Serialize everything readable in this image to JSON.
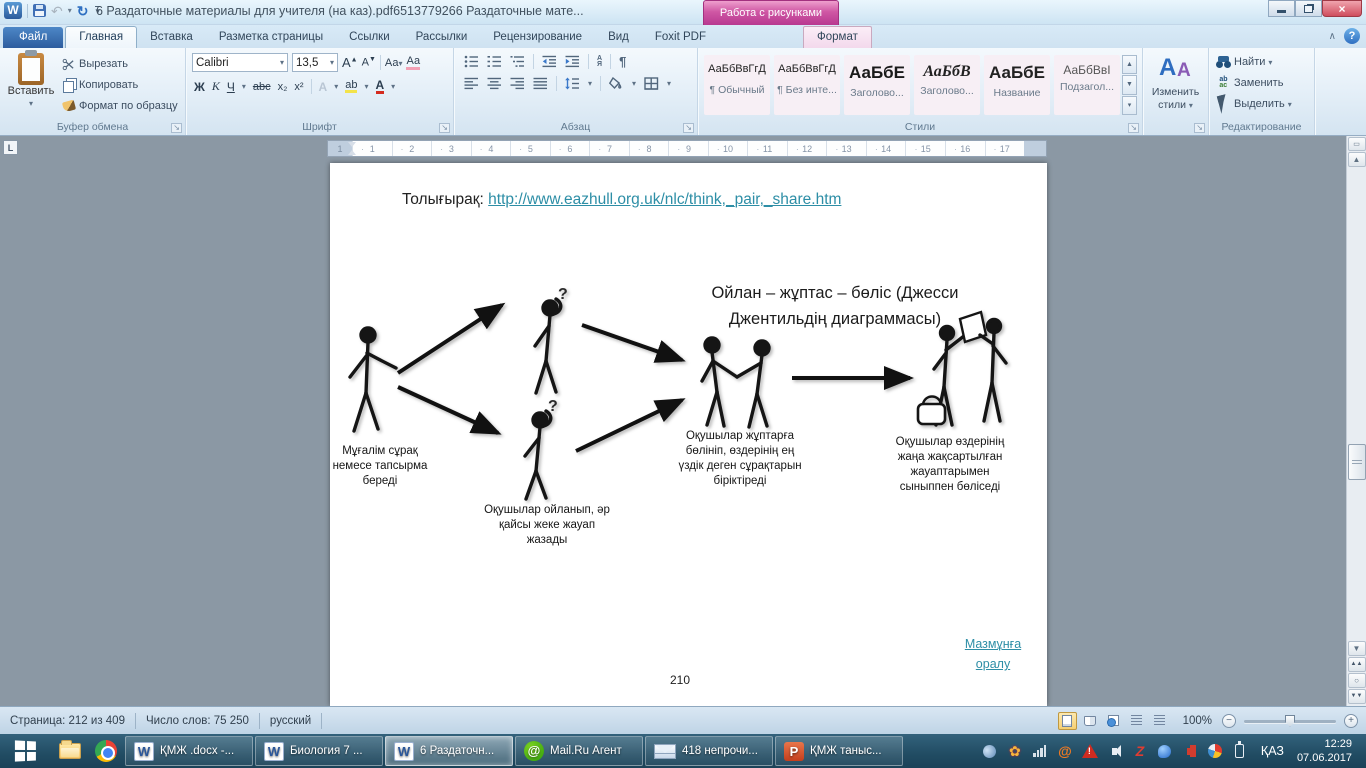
{
  "icons": {
    "dropdown": "▾",
    "up_arrow": "▲",
    "down_arrow": "▼",
    "circle": "○",
    "double_up": "▲▲",
    "double_down": "▼▼",
    "pilcrow": "¶",
    "undo": "↶",
    "redo": "↻",
    "collapse_ribbon": "∧",
    "help": "?",
    "close": "×",
    "minus": "−",
    "plus": "+",
    "at_sign": "@",
    "flower": "✿",
    "ruler_toggle": "▭"
  },
  "titlebar": {
    "title": "6 Раздаточные материалы для учителя (на каз).pdf6513779266 Раздаточные мате...",
    "contextual_header": "Работа с рисунками"
  },
  "tabs": {
    "file": "Файл",
    "items": [
      "Главная",
      "Вставка",
      "Разметка страницы",
      "Ссылки",
      "Рассылки",
      "Рецензирование",
      "Вид",
      "Foxit PDF"
    ],
    "contextual": "Формат"
  },
  "ribbon": {
    "clipboard": {
      "label": "Буфер обмена",
      "paste": "Вставить",
      "cut": "Вырезать",
      "copy": "Копировать",
      "painter": "Формат по образцу"
    },
    "font": {
      "label": "Шрифт",
      "family": "Calibri",
      "size": "13,5",
      "grow": "А",
      "shrink": "А",
      "case": "Аа",
      "clear": "Аа",
      "bold": "Ж",
      "italic": "К",
      "underline": "Ч",
      "strike": "abc",
      "subscript": "x₂",
      "superscript": "x²",
      "effects": "А",
      "highlight": "ab",
      "color": "А"
    },
    "paragraph": {
      "label": "Абзац",
      "sort_top": "А",
      "sort_bottom": "Я"
    },
    "styles": {
      "label": "Стили",
      "items": [
        {
          "preview": "АаБбВвГгД",
          "name": "¶ Обычный"
        },
        {
          "preview": "АаБбВвГгД",
          "name": "¶ Без инте..."
        },
        {
          "preview": "АаБбЕ",
          "name": "Заголово..."
        },
        {
          "preview": "АаБбВ",
          "name": "Заголово..."
        },
        {
          "preview": "АаБбЕ",
          "name": "Название"
        },
        {
          "preview": "АаБбВвІ",
          "name": "Подзагол..."
        }
      ]
    },
    "change_styles": {
      "line1": "Изменить",
      "line2": "стили"
    },
    "editing": {
      "label": "Редактирование",
      "find": "Найти",
      "replace": "Заменить",
      "select": "Выделить",
      "replace_ic1": "ab",
      "replace_ic2": "ac"
    }
  },
  "ruler": {
    "margin_number": "1",
    "numbers": [
      "1",
      "2",
      "3",
      "4",
      "5",
      "6",
      "7",
      "8",
      "9",
      "10",
      "11",
      "12",
      "13",
      "14",
      "15",
      "16",
      "17"
    ]
  },
  "document": {
    "more_label": "Толығырақ:",
    "link": "http://www.eazhull.org.uk/nlc/think,_pair,_share.htm",
    "diagram_title": "Ойлан – жұптас – бөліс (Джесси Джентильдің диаграммасы)",
    "question_mark": "?",
    "captions": [
      "Мұғалім сұрақ немесе тапсырма береді",
      "Оқушылар ойланып, әр қайсы жеке жауап жазады",
      "Оқушылар жұптарға бөлініп, өздерінің ең үздік деген сұрақтарын біріктіреді",
      "Оқушылар өздерінің жаңа жақсартылған жауаптарымен сыныппен бөліседі"
    ],
    "back_link": "Мазмұнға оралу",
    "page_number": "210"
  },
  "statusbar": {
    "page": "Страница: 212 из 409",
    "words": "Число слов: 75 250",
    "language": "русский",
    "zoom": "100%"
  },
  "taskbar": {
    "buttons": [
      {
        "label": "ҚМЖ .docx -..."
      },
      {
        "label": "Биология 7 ..."
      },
      {
        "label": "6 Раздаточн..."
      },
      {
        "label": "Mail.Ru Агент"
      },
      {
        "label": "418 непрочи..."
      },
      {
        "label": "ҚМЖ таныс..."
      }
    ],
    "tray_language": "ҚАЗ",
    "time": "12:29",
    "date": "07.06.2017"
  }
}
